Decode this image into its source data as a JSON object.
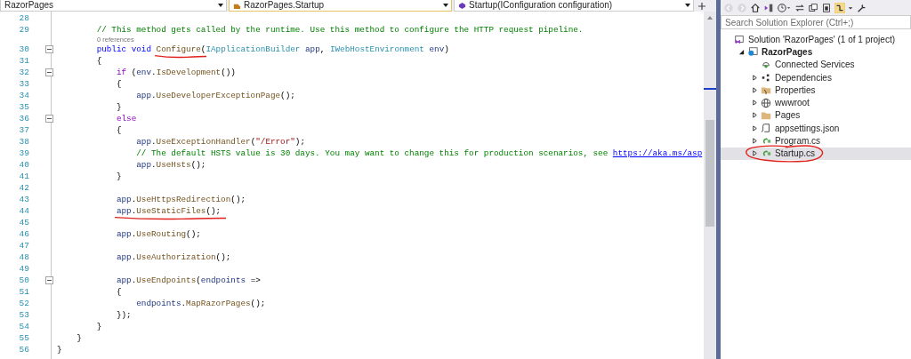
{
  "navigation_bar": [
    {
      "kind": "project",
      "text": "RazorPages"
    },
    {
      "kind": "class",
      "text": "RazorPages.Startup"
    },
    {
      "kind": "member",
      "text": "Startup(IConfiguration configuration)"
    }
  ],
  "code_lines": [
    {
      "kind": "code",
      "num": "28",
      "fold": false
    },
    {
      "kind": "code",
      "num": "29",
      "fold": false,
      "tokens": [
        {
          "kind": "comment",
          "text": "        // This method gets called by the runtime. Use this method to configure the HTTP request pipeline."
        }
      ]
    },
    {
      "kind": "codelens",
      "text": "0 references"
    },
    {
      "kind": "code",
      "num": "30",
      "fold": true,
      "tokens": [
        {
          "kind": "keyword",
          "text": "        public void "
        },
        {
          "kind": "annotated",
          "tokens": [
            {
              "kind": "method",
              "text": "Configure"
            }
          ]
        },
        {
          "kind": "plain",
          "text": "("
        },
        {
          "kind": "type",
          "text": "IApplicationBuilder"
        },
        {
          "kind": "param",
          "text": " app"
        },
        {
          "kind": "plain",
          "text": ", "
        },
        {
          "kind": "type",
          "text": "IWebHostEnvironment"
        },
        {
          "kind": "param",
          "text": " env"
        },
        {
          "kind": "plain",
          "text": ")"
        }
      ]
    },
    {
      "kind": "code",
      "num": "31",
      "fold": false,
      "tokens": [
        {
          "kind": "plain",
          "text": "        {"
        }
      ]
    },
    {
      "kind": "code",
      "num": "32",
      "fold": true,
      "tokens": [
        {
          "kind": "control",
          "text": "            if"
        },
        {
          "kind": "plain",
          "text": " ("
        },
        {
          "kind": "param",
          "text": "env"
        },
        {
          "kind": "plain",
          "text": "."
        },
        {
          "kind": "method",
          "text": "IsDevelopment"
        },
        {
          "kind": "plain",
          "text": "())"
        }
      ]
    },
    {
      "kind": "code",
      "num": "33",
      "fold": false,
      "tokens": [
        {
          "kind": "plain",
          "text": "            {"
        }
      ]
    },
    {
      "kind": "code",
      "num": "34",
      "fold": false,
      "tokens": [
        {
          "kind": "param",
          "text": "                app"
        },
        {
          "kind": "plain",
          "text": "."
        },
        {
          "kind": "method",
          "text": "UseDeveloperExceptionPage"
        },
        {
          "kind": "plain",
          "text": "();"
        }
      ]
    },
    {
      "kind": "code",
      "num": "35",
      "fold": false,
      "tokens": [
        {
          "kind": "plain",
          "text": "            }"
        }
      ]
    },
    {
      "kind": "code",
      "num": "36",
      "fold": true,
      "tokens": [
        {
          "kind": "control",
          "text": "            else"
        }
      ]
    },
    {
      "kind": "code",
      "num": "37",
      "fold": false,
      "tokens": [
        {
          "kind": "plain",
          "text": "            {"
        }
      ]
    },
    {
      "kind": "code",
      "num": "38",
      "fold": false,
      "tokens": [
        {
          "kind": "param",
          "text": "                app"
        },
        {
          "kind": "plain",
          "text": "."
        },
        {
          "kind": "method",
          "text": "UseExceptionHandler"
        },
        {
          "kind": "plain",
          "text": "("
        },
        {
          "kind": "string",
          "text": "\"/Error\""
        },
        {
          "kind": "plain",
          "text": ");"
        }
      ]
    },
    {
      "kind": "code",
      "num": "39",
      "fold": false,
      "tokens": [
        {
          "kind": "comment",
          "text": "                // The default HSTS value is 30 days. You may want to change this for production scenarios, see "
        },
        {
          "kind": "link",
          "text": "https://aka.ms/asp"
        }
      ]
    },
    {
      "kind": "code",
      "num": "40",
      "fold": false,
      "tokens": [
        {
          "kind": "param",
          "text": "                app"
        },
        {
          "kind": "plain",
          "text": "."
        },
        {
          "kind": "method",
          "text": "UseHsts"
        },
        {
          "kind": "plain",
          "text": "();"
        }
      ]
    },
    {
      "kind": "code",
      "num": "41",
      "fold": false,
      "tokens": [
        {
          "kind": "plain",
          "text": "            }"
        }
      ]
    },
    {
      "kind": "code",
      "num": "42",
      "fold": false
    },
    {
      "kind": "code",
      "num": "43",
      "fold": false,
      "tokens": [
        {
          "kind": "param",
          "text": "            app"
        },
        {
          "kind": "plain",
          "text": "."
        },
        {
          "kind": "method",
          "text": "UseHttpsRedirection"
        },
        {
          "kind": "plain",
          "text": "();"
        }
      ]
    },
    {
      "kind": "code",
      "num": "44",
      "fold": false,
      "tokens": [
        {
          "kind": "annotated",
          "tokens": [
            {
              "kind": "param",
              "text": "            app"
            },
            {
              "kind": "plain",
              "text": "."
            },
            {
              "kind": "method",
              "text": "UseStaticFiles"
            },
            {
              "kind": "plain",
              "text": "();"
            }
          ]
        }
      ]
    },
    {
      "kind": "code",
      "num": "45",
      "fold": false
    },
    {
      "kind": "code",
      "num": "46",
      "fold": false,
      "tokens": [
        {
          "kind": "param",
          "text": "            app"
        },
        {
          "kind": "plain",
          "text": "."
        },
        {
          "kind": "method",
          "text": "UseRouting"
        },
        {
          "kind": "plain",
          "text": "();"
        }
      ]
    },
    {
      "kind": "code",
      "num": "47",
      "fold": false
    },
    {
      "kind": "code",
      "num": "48",
      "fold": false,
      "tokens": [
        {
          "kind": "param",
          "text": "            app"
        },
        {
          "kind": "plain",
          "text": "."
        },
        {
          "kind": "method",
          "text": "UseAuthorization"
        },
        {
          "kind": "plain",
          "text": "();"
        }
      ]
    },
    {
      "kind": "code",
      "num": "49",
      "fold": false
    },
    {
      "kind": "code",
      "num": "50",
      "fold": true,
      "tokens": [
        {
          "kind": "param",
          "text": "            app"
        },
        {
          "kind": "plain",
          "text": "."
        },
        {
          "kind": "method",
          "text": "UseEndpoints"
        },
        {
          "kind": "plain",
          "text": "("
        },
        {
          "kind": "param",
          "text": "endpoints"
        },
        {
          "kind": "plain",
          "text": " =>"
        }
      ]
    },
    {
      "kind": "code",
      "num": "51",
      "fold": false,
      "tokens": [
        {
          "kind": "plain",
          "text": "            {"
        }
      ]
    },
    {
      "kind": "code",
      "num": "52",
      "fold": false,
      "tokens": [
        {
          "kind": "param",
          "text": "                endpoints"
        },
        {
          "kind": "plain",
          "text": "."
        },
        {
          "kind": "method",
          "text": "MapRazorPages"
        },
        {
          "kind": "plain",
          "text": "();"
        }
      ]
    },
    {
      "kind": "code",
      "num": "53",
      "fold": false,
      "tokens": [
        {
          "kind": "plain",
          "text": "            });"
        }
      ]
    },
    {
      "kind": "code",
      "num": "54",
      "fold": false,
      "tokens": [
        {
          "kind": "plain",
          "text": "        }"
        }
      ]
    },
    {
      "kind": "code",
      "num": "55",
      "fold": false,
      "tokens": [
        {
          "kind": "plain",
          "text": "    }"
        }
      ]
    },
    {
      "kind": "code",
      "num": "56",
      "fold": false,
      "tokens": [
        {
          "kind": "plain",
          "text": "}"
        }
      ]
    }
  ],
  "solution_explorer": {
    "search": {
      "placeholder": "Search Solution Explorer (Ctrl+;)"
    },
    "tree": [
      {
        "kind": "solution",
        "label": "Solution 'RazorPages' (1 of 1 project)",
        "selected": false,
        "circled": false,
        "children": [
          {
            "kind": "project",
            "label": "RazorPages",
            "expanded": true,
            "selected": false,
            "circled": false,
            "children": [
              {
                "kind": "service",
                "label": "Connected Services",
                "selected": false,
                "circled": false
              },
              {
                "kind": "dependencies",
                "label": "Dependencies",
                "expanded": false,
                "selected": false,
                "circled": false
              },
              {
                "kind": "properties",
                "label": "Properties",
                "expanded": false,
                "selected": false,
                "circled": false
              },
              {
                "kind": "web",
                "label": "wwwroot",
                "expanded": false,
                "selected": false,
                "circled": false
              },
              {
                "kind": "folder",
                "label": "Pages",
                "expanded": false,
                "selected": false,
                "circled": false
              },
              {
                "kind": "json",
                "label": "appsettings.json",
                "expanded": false,
                "selected": false,
                "circled": false
              },
              {
                "kind": "csharp",
                "label": "Program.cs",
                "expanded": false,
                "selected": false,
                "circled": false
              },
              {
                "kind": "csharp",
                "label": "Startup.cs",
                "expanded": false,
                "selected": true,
                "circled": true
              }
            ]
          }
        ]
      }
    ]
  }
}
